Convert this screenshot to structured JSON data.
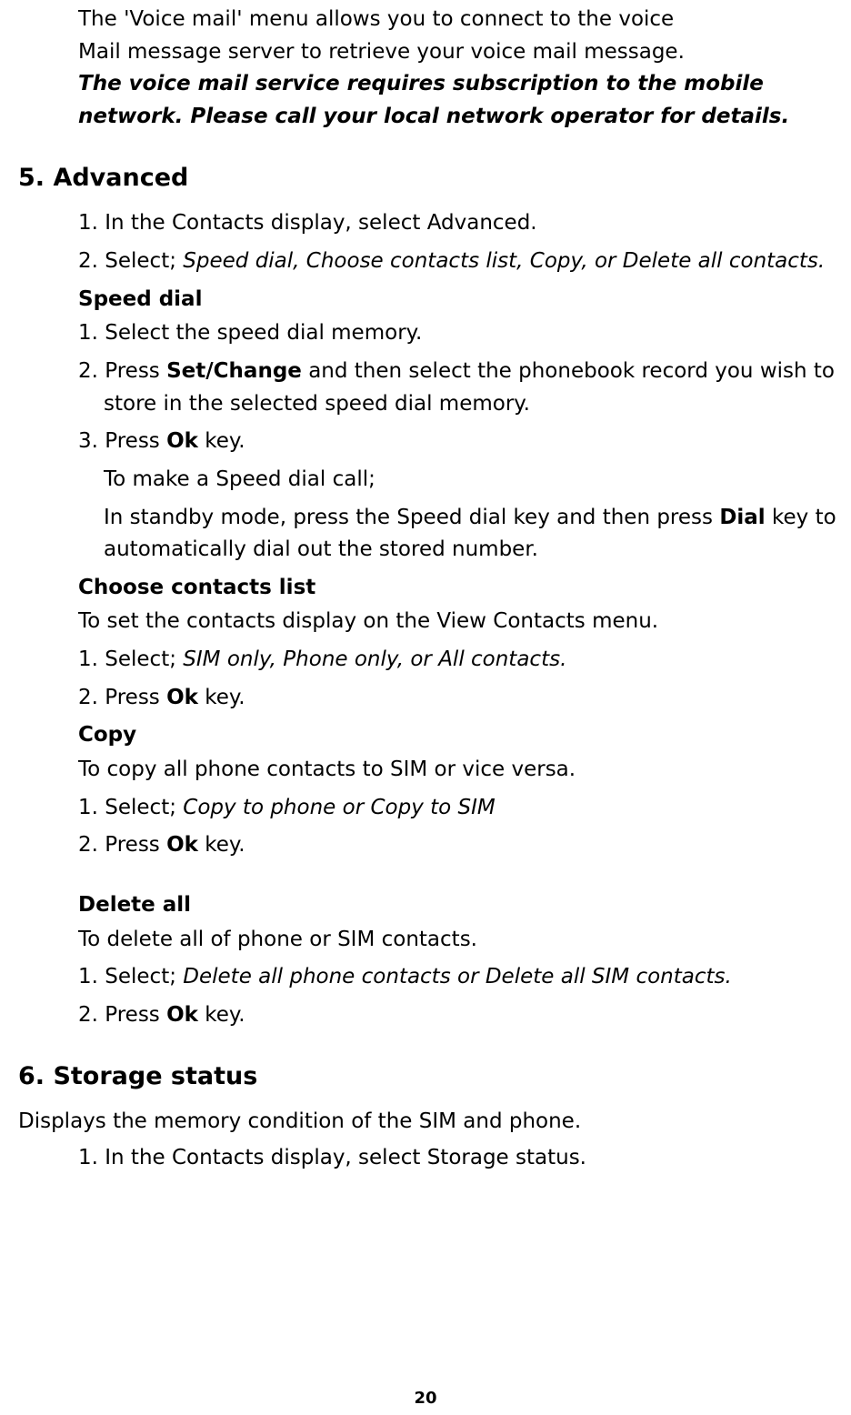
{
  "intro": {
    "l1": "The 'Voice mail' menu allows you to connect to the voice",
    "l2": "Mail message server to retrieve your voice mail message.",
    "emph1": "The voice mail service requires subscription to the mobile",
    "emph2": "network. Please call your local network operator for details."
  },
  "h5": "5. Advanced",
  "adv": {
    "s1": "1. In the Contacts display, select Advanced.",
    "s2a": "2. Select; ",
    "s2b": "Speed dial, Choose contacts list, Copy, or Delete all contacts."
  },
  "speed": {
    "head": "Speed dial",
    "s1": "1. Select the speed dial memory.",
    "s2a": "2. Press ",
    "s2b": "Set/Change",
    "s2c": " and then select the phonebook record you wish to store in the selected speed dial memory.",
    "s3a": "3. Press ",
    "s3b": "Ok",
    "s3c": " key.",
    "tip1": "To make a Speed dial call;",
    "tip2a": "In standby mode, press the Speed dial key and then press ",
    "tip2b": "Dial",
    "tip2c": " key to automatically dial out the stored number."
  },
  "choose": {
    "head": "Choose contacts list",
    "desc": "To set the contacts display on the View Contacts menu.",
    "s1a": "1. Select; ",
    "s1b": "SIM only, Phone only, or All contacts.",
    "s2a": "2. Press ",
    "s2b": "Ok",
    "s2c": " key."
  },
  "copy": {
    "head": "Copy",
    "desc": "To copy all phone contacts to SIM or vice versa.",
    "s1a": "1. Select; ",
    "s1b": "Copy to phone or Copy to SIM",
    "s2a": "2. Press ",
    "s2b": "Ok",
    "s2c": " key."
  },
  "del": {
    "head": "Delete all",
    "desc": "To delete all of phone or SIM contacts.",
    "s1a": "1. Select; ",
    "s1b": "Delete all phone contacts or Delete all SIM contacts.",
    "s2a": "2. Press ",
    "s2b": "Ok",
    "s2c": " key."
  },
  "h6": "6. Storage status",
  "storage": {
    "desc": "Displays the memory condition of the SIM and phone.",
    "s1": "1. In the Contacts display, select Storage status."
  },
  "pagenum": "20"
}
